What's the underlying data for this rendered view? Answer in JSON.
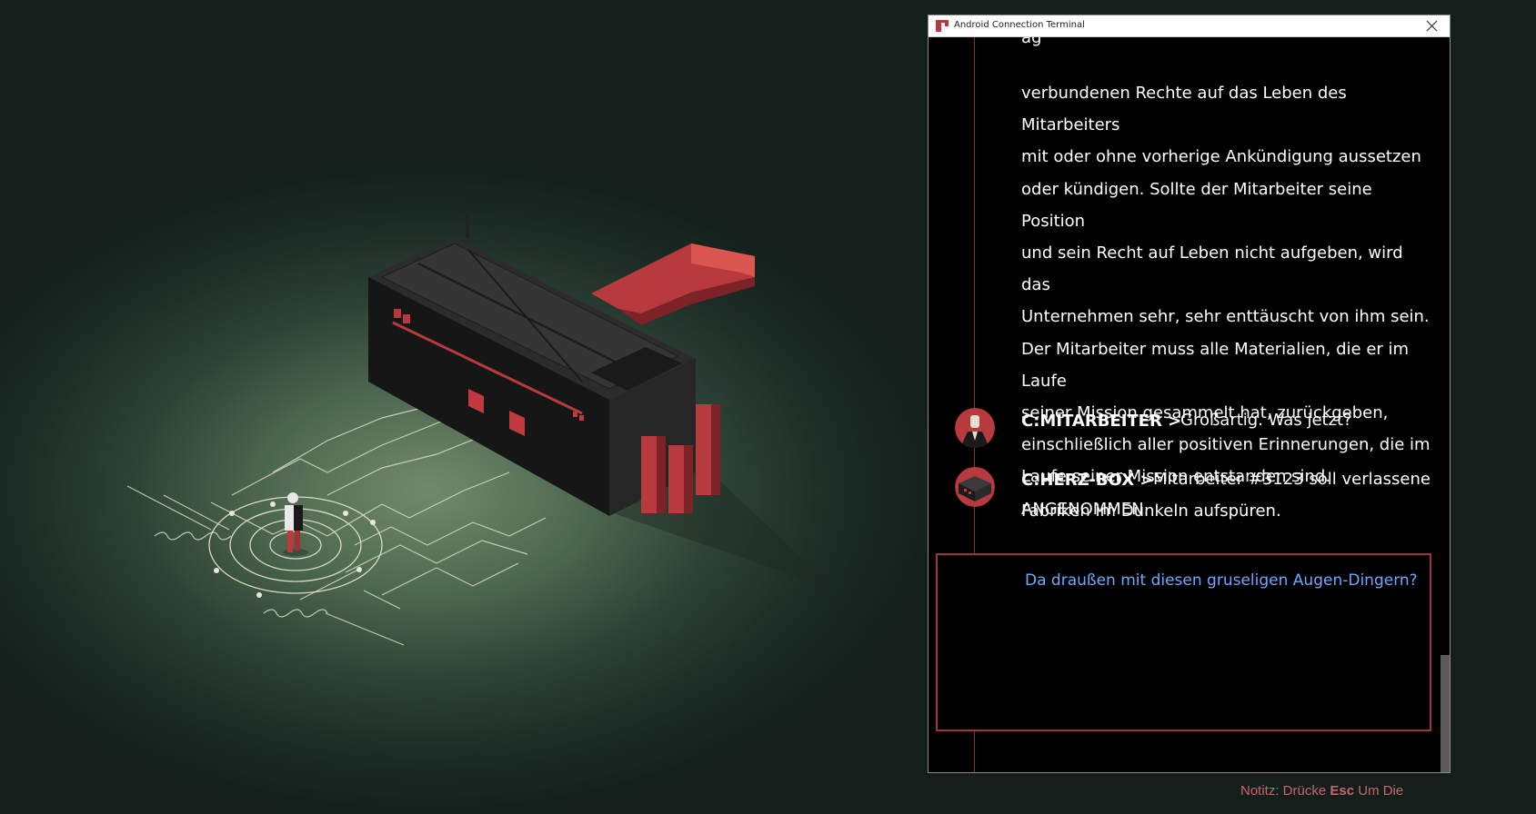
{
  "window": {
    "title": "Android Connection Terminal",
    "close_glyph": "×"
  },
  "contract": {
    "partial_line": "ag",
    "text": "verbundenen Rechte auf das Leben des Mitarbeiters\nmit oder ohne vorherige Ankündigung aussetzen\noder kündigen. Sollte der Mitarbeiter seine Position\nund sein Recht auf Leben nicht aufgeben, wird das\nUnternehmen sehr, sehr enttäuscht von ihm sein.\nDer Mitarbeiter muss alle Materialien, die er im Laufe\nseiner Mission gesammelt hat, zurückgeben,\neinschließlich aller positiven Erinnerungen, die im\nLaufe seiner Mission entstanden sind.\nANGENOMMEN."
  },
  "messages": [
    {
      "speaker": "C:MITARBEITER >",
      "avatar": "employee-avatar-icon",
      "text": "Großartig. Was jetzt?"
    },
    {
      "speaker": "C:HERZ-BOX >",
      "avatar": "heart-box-avatar-icon",
      "text_line1": "Mitarbeiter #3123 soll verlassene",
      "text_line2": "Fabriken im Dunkeln aufspüren."
    }
  ],
  "dialogue_options": [
    {
      "text": "Da draußen mit diesen gruseligen Augen-Dingern?"
    }
  ],
  "footer_note": {
    "prefix": "Notitz: Drücke ",
    "key": "Esc",
    "suffix": " Um Die"
  },
  "colors": {
    "accent_red": "#9d3344",
    "option_blue": "#6fa8ff",
    "note_red": "#c9646f",
    "machine_red": "#c0393f"
  }
}
